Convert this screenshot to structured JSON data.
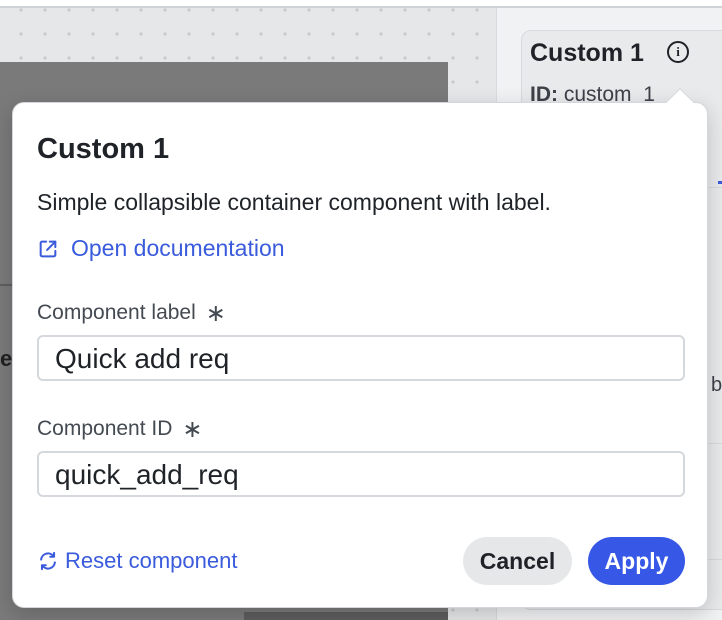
{
  "panel": {
    "title": "Custom 1",
    "info_icon": "info-icon",
    "id_label": "ID:",
    "id_value": "custom_1",
    "cut_text": "b"
  },
  "popover": {
    "title": "Custom 1",
    "description": "Simple collapsible container component with label.",
    "doc_link": {
      "label": "Open documentation",
      "icon": "external-link-icon"
    },
    "label_field": {
      "label": "Component label",
      "required_mark": "∗",
      "value": "Quick add req"
    },
    "id_field": {
      "label": "Component ID",
      "required_mark": "∗",
      "value": "quick_add_req"
    },
    "reset": {
      "label": "Reset component",
      "icon": "refresh-icon"
    },
    "cancel_label": "Cancel",
    "apply_label": "Apply"
  },
  "colors": {
    "accent": "#3758e6",
    "link": "#3a5bdc",
    "overlay": "#7a7a7a"
  }
}
